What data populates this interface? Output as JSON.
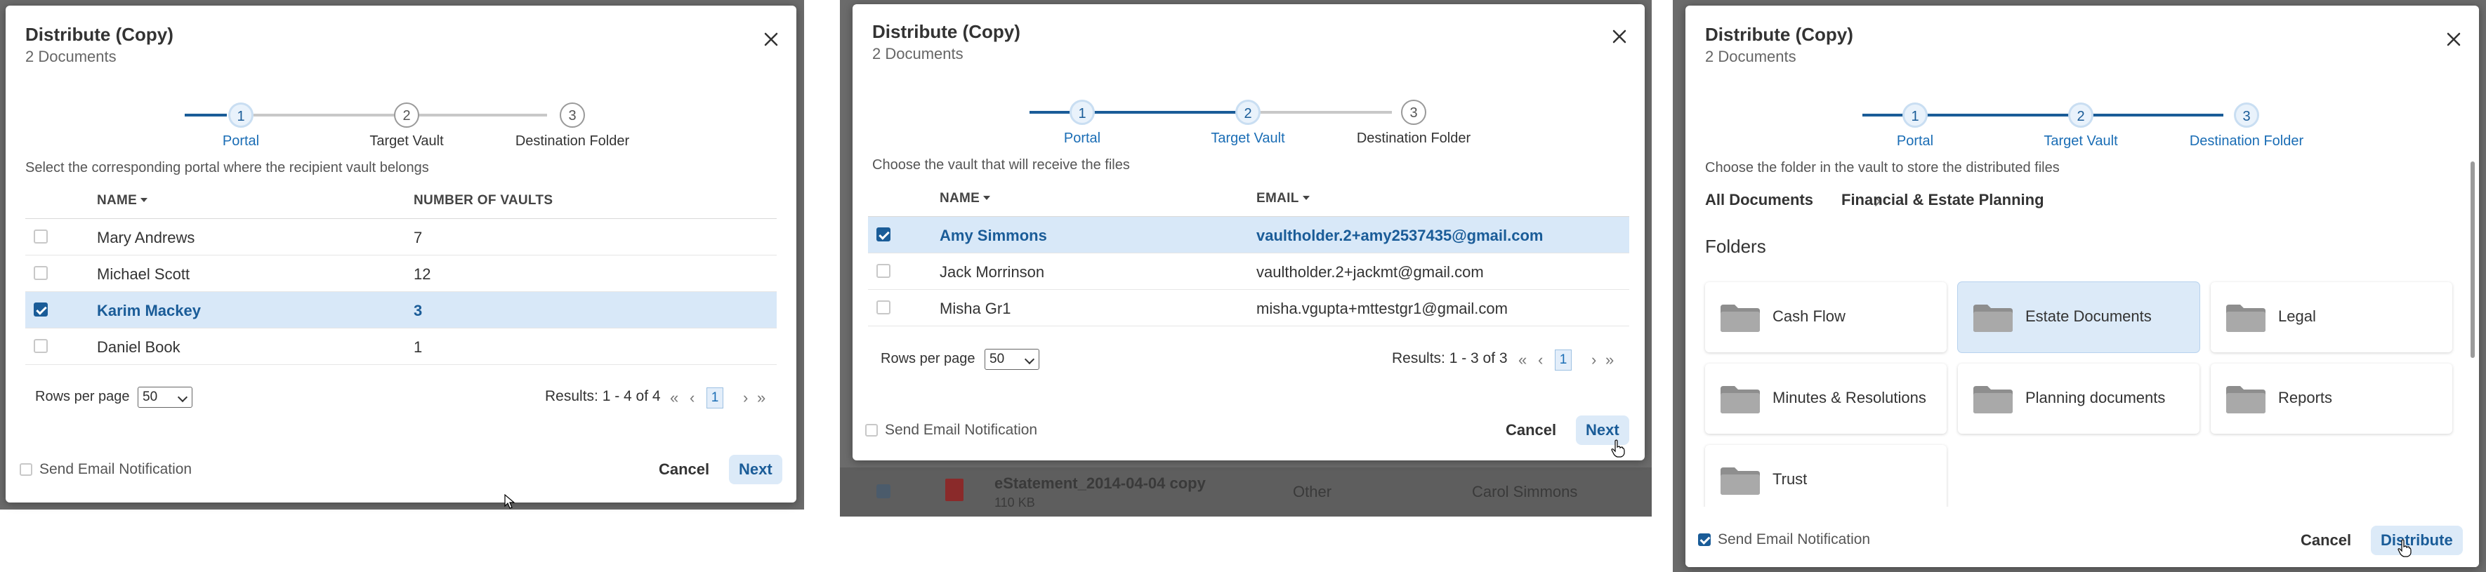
{
  "panel1": {
    "title": "Distribute (Copy)",
    "subtitle": "2 Documents",
    "steps": [
      "Portal",
      "Target Vault",
      "Destination Folder"
    ],
    "step_numbers": [
      "1",
      "2",
      "3"
    ],
    "instruction": "Select the corresponding portal where the recipient vault belongs",
    "columns": [
      "NAME",
      "NUMBER OF VAULTS"
    ],
    "rows": [
      {
        "name": "Mary Andrews",
        "value": "7",
        "selected": false
      },
      {
        "name": "Michael Scott",
        "value": "12",
        "selected": false
      },
      {
        "name": "Karim Mackey",
        "value": "3",
        "selected": true
      },
      {
        "name": "Daniel Book",
        "value": "1",
        "selected": false
      }
    ],
    "rows_per_page_label": "Rows per page",
    "rows_per_page_value": "50",
    "results": "Results: 1 - 4 of 4",
    "page": "1",
    "pager": {
      "first": "«",
      "prev": "‹",
      "next": "›",
      "last": "»"
    },
    "notify_label": "Send Email Notification",
    "notify_checked": false,
    "cancel": "Cancel",
    "next": "Next"
  },
  "panel2": {
    "title": "Distribute (Copy)",
    "subtitle": "2 Documents",
    "steps": [
      "Portal",
      "Target Vault",
      "Destination Folder"
    ],
    "step_numbers": [
      "1",
      "2",
      "3"
    ],
    "instruction": "Choose the vault that will receive the files",
    "columns": [
      "NAME",
      "EMAIL"
    ],
    "rows": [
      {
        "name": "Amy Simmons",
        "value": "vaultholder.2+amy2537435@gmail.com",
        "selected": true
      },
      {
        "name": "Jack Morrinson",
        "value": "vaultholder.2+jackmt@gmail.com",
        "selected": false
      },
      {
        "name": "Misha Gr1",
        "value": "misha.vgupta+mttestgr1@gmail.com",
        "selected": false
      }
    ],
    "rows_per_page_label": "Rows per page",
    "rows_per_page_value": "50",
    "results": "Results: 1 - 3 of 3",
    "page": "1",
    "pager": {
      "first": "«",
      "prev": "‹",
      "next": "›",
      "last": "»"
    },
    "notify_label": "Send Email Notification",
    "notify_checked": false,
    "cancel": "Cancel",
    "next": "Next",
    "background_row": {
      "file": "eStatement_2014-04-04 copy",
      "size": "110 KB",
      "type": "Other",
      "owner": "Carol Simmons"
    }
  },
  "panel3": {
    "title": "Distribute (Copy)",
    "subtitle": "2 Documents",
    "steps": [
      "Portal",
      "Target Vault",
      "Destination Folder"
    ],
    "step_numbers": [
      "1",
      "2",
      "3"
    ],
    "instruction": "Choose the folder in the vault to store the distributed files",
    "breadcrumb": [
      "All Documents",
      "Financial & Estate Planning"
    ],
    "folders_title": "Folders",
    "folders": [
      {
        "name": "Cash Flow",
        "selected": false
      },
      {
        "name": "Estate Documents",
        "selected": true
      },
      {
        "name": "Legal",
        "selected": false
      },
      {
        "name": "Minutes & Resolutions",
        "selected": false
      },
      {
        "name": "Planning documents",
        "selected": false
      },
      {
        "name": "Reports",
        "selected": false
      },
      {
        "name": "Trust",
        "selected": false
      }
    ],
    "notify_label": "Send Email Notification",
    "notify_checked": true,
    "cancel": "Cancel",
    "distribute": "Distribute"
  },
  "colors": {
    "accent": "#1a5c98",
    "accent_light": "#dceaf8",
    "selected_row": "#d8e8f8",
    "backdrop": "#6b6b6b"
  }
}
